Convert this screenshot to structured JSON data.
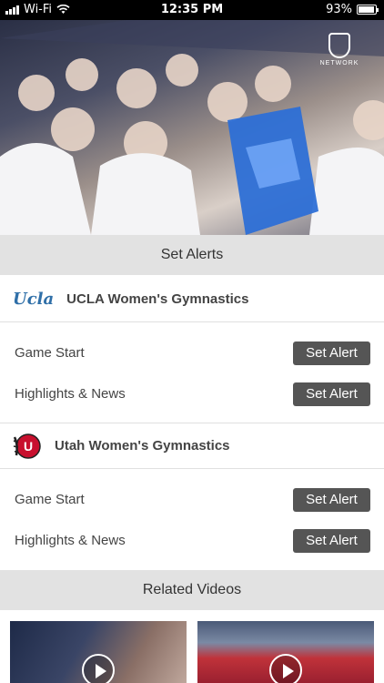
{
  "status_bar": {
    "carrier": "Wi-Fi",
    "time": "12:35 PM",
    "battery": "93%",
    "battery_level": 0.93
  },
  "hero": {
    "network_logo_text": "NETWORK"
  },
  "alerts_section": {
    "title": "Set Alerts",
    "teams": [
      {
        "logo_text": "Ucla",
        "name": "UCLA Women's Gymnastics",
        "rows": [
          {
            "label": "Game Start",
            "button": "Set Alert"
          },
          {
            "label": "Highlights & News",
            "button": "Set Alert"
          }
        ]
      },
      {
        "logo_text": "U",
        "name": "Utah Women's Gymnastics",
        "rows": [
          {
            "label": "Game Start",
            "button": "Set Alert"
          },
          {
            "label": "Highlights & News",
            "button": "Set Alert"
          }
        ]
      }
    ]
  },
  "related_section": {
    "title": "Related Videos"
  },
  "colors": {
    "section_bar": "#e2e2e2",
    "button": "#555555",
    "ucla_blue": "#2f6fa8",
    "utah_red": "#c8102e"
  }
}
